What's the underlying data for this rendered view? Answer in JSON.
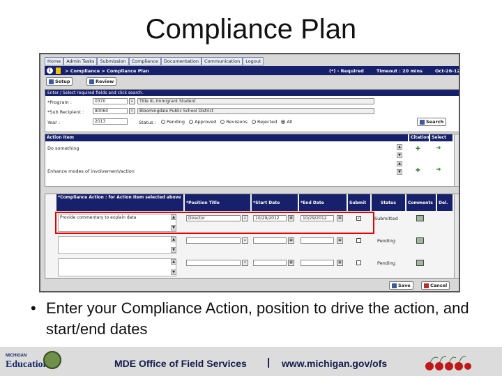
{
  "slide": {
    "title": "Compliance Plan",
    "bullet": "Enter your Compliance Action, position to drive the action, and start/end dates"
  },
  "app": {
    "tabs": [
      "Home",
      "Admin Tasks",
      "Submission",
      "Compliance",
      "Documentation",
      "Communication",
      "Logout"
    ],
    "breadcrumb": "> Compliance > Compliance Plan",
    "required_note": "(*) - Required",
    "timeout": "Timeout : 20 mins",
    "date": "Oct-26-12",
    "setup_label": "Setup",
    "review_label": "Review",
    "filter": {
      "header": "Enter / Select required fields and click search.",
      "program_label": "*Program :",
      "program_code": "0370",
      "program_name": "Title III, Immigrant Student",
      "recipient_label": "*Sub Recipient :",
      "recipient_code": "80060",
      "recipient_name": "Bloomingdale Public School District",
      "year_label": "Year :",
      "year_value": "2013",
      "status_label": "Status :",
      "status_options": [
        "Pending",
        "Approved",
        "Revisions",
        "Rejected",
        "All"
      ],
      "status_selected": "All",
      "search_label": "Search"
    },
    "action_items": {
      "headers": {
        "item": "Action Item",
        "citation": "Citation",
        "select": "Select"
      },
      "rows": [
        "Do something",
        "Enhance modes of involvement/action"
      ]
    },
    "compliance": {
      "headers": {
        "action": "*Compliance Action : for Action Item selected above",
        "position": "*Position Title",
        "start": "*Start Date",
        "end": "*End Date",
        "submit": "Submit",
        "status": "Status",
        "comments": "Comments",
        "del": "Del."
      },
      "rows": [
        {
          "action": "Provide commentary to explain data",
          "position": "Director",
          "start": "10/29/2012",
          "end": "10/29/2012",
          "submitted": true,
          "status": "Submitted"
        },
        {
          "action": "",
          "position": "",
          "start": "",
          "end": "",
          "submitted": false,
          "status": "Pending"
        },
        {
          "action": "",
          "position": "",
          "start": "",
          "end": "",
          "submitted": false,
          "status": "Pending"
        }
      ]
    },
    "save_label": "Save",
    "cancel_label": "Cancel"
  },
  "footer": {
    "logo_small": "MICHIGAN",
    "logo_big": "Education",
    "office": "MDE Office of Field Services",
    "separator": "|",
    "url": "www.michigan.gov/ofs"
  },
  "colors": {
    "header_bar": "#17216b",
    "highlight": "#e00000",
    "footer_bg": "#dcdcdc"
  }
}
